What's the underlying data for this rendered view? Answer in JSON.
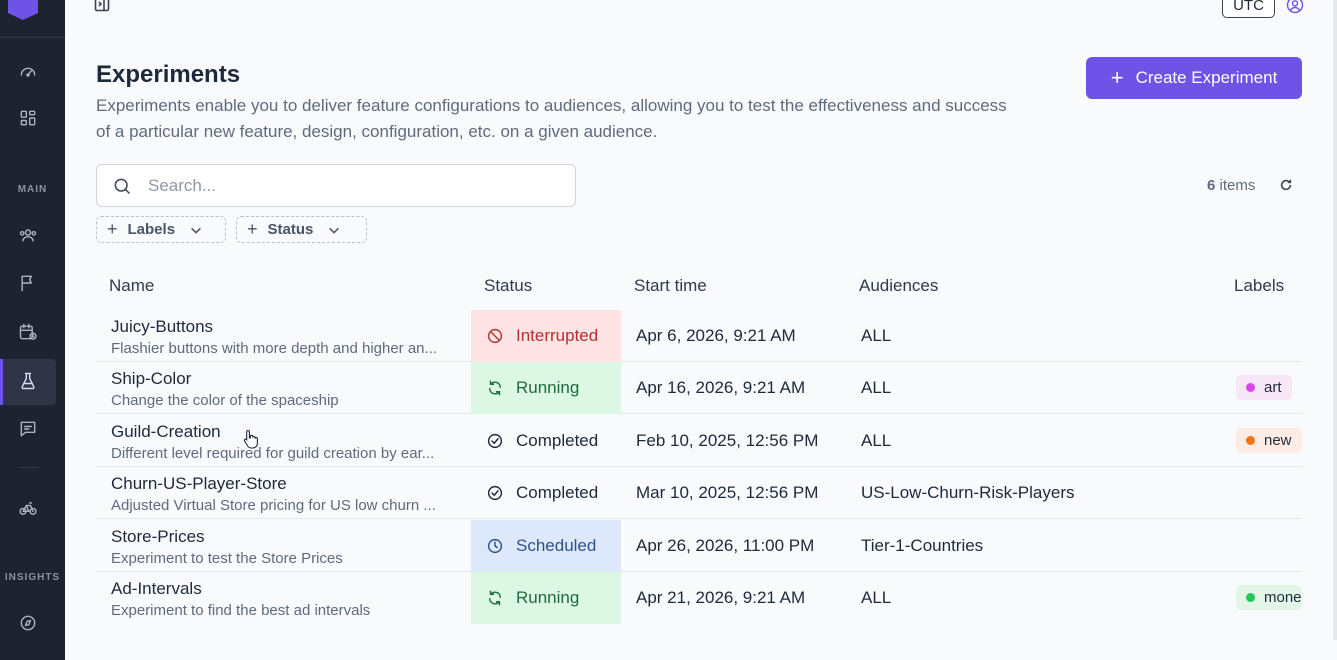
{
  "sidebar": {
    "sections": {
      "main": "MAIN",
      "insights": "INSIGHTS"
    },
    "items": [
      {
        "icon": "dashboard-gauge-icon"
      },
      {
        "icon": "apps-grid-icon"
      },
      {
        "icon": "users-icon"
      },
      {
        "icon": "flag-icon"
      },
      {
        "icon": "calendar-clock-icon"
      },
      {
        "icon": "flask-icon",
        "active": true
      },
      {
        "icon": "feedback-icon"
      },
      {
        "icon": "bicycle-icon"
      },
      {
        "icon": "compass-icon"
      }
    ]
  },
  "header": {
    "timezone": "UTC"
  },
  "page": {
    "title": "Experiments",
    "description": "Experiments enable you to deliver feature configurations to audiences, allowing you to test the effectiveness and success of a particular new feature, design, configuration, etc. on a given audience.",
    "create_button": "Create Experiment",
    "create_plus": "+"
  },
  "search": {
    "placeholder": "Search..."
  },
  "items_count": {
    "number": "6",
    "suffix": " items"
  },
  "filters": [
    {
      "label": "Labels",
      "plus": "+"
    },
    {
      "label": "Status",
      "plus": "+"
    }
  ],
  "table": {
    "headers": {
      "name": "Name",
      "status": "Status",
      "start": "Start time",
      "audiences": "Audiences",
      "labels": "Labels"
    },
    "rows": [
      {
        "name": "Juicy-Buttons",
        "desc": "Flashier buttons with more depth and higher an...",
        "status": "Interrupted",
        "start": "Apr 6, 2026, 9:21 AM",
        "audiences": "ALL",
        "label": ""
      },
      {
        "name": "Ship-Color",
        "desc": "Change the color of the spaceship",
        "status": "Running",
        "start": "Apr 16, 2026, 9:21 AM",
        "audiences": "ALL",
        "label": "art",
        "label_color": "#d946ef"
      },
      {
        "name": "Guild-Creation",
        "desc": "Different level required for guild creation by ear...",
        "status": "Completed",
        "start": "Feb 10, 2025, 12:56 PM",
        "audiences": "ALL",
        "label": "new",
        "label_color": "#f97316"
      },
      {
        "name": "Churn-US-Player-Store",
        "desc": "Adjusted Virtual Store pricing for US low churn ...",
        "status": "Completed",
        "start": "Mar 10, 2025, 12:56 PM",
        "audiences": "US-Low-Churn-Risk-Players",
        "label": ""
      },
      {
        "name": "Store-Prices",
        "desc": "Experiment to test the Store Prices",
        "status": "Scheduled",
        "start": "Apr 26, 2026, 11:00 PM",
        "audiences": "Tier-1-Countries",
        "label": ""
      },
      {
        "name": "Ad-Intervals",
        "desc": "Experiment to find the best ad intervals",
        "status": "Running",
        "start": "Apr 21, 2026, 9:21 AM",
        "audiences": "ALL",
        "label": "mone",
        "label_color": "#22c55e"
      }
    ]
  },
  "colors": {
    "accent": "#6d54e6",
    "sidebar_bg": "#1e2330",
    "interrupted_bg": "#fde3e3",
    "running_bg": "#dcf7e3",
    "scheduled_bg": "#dde9fb"
  }
}
